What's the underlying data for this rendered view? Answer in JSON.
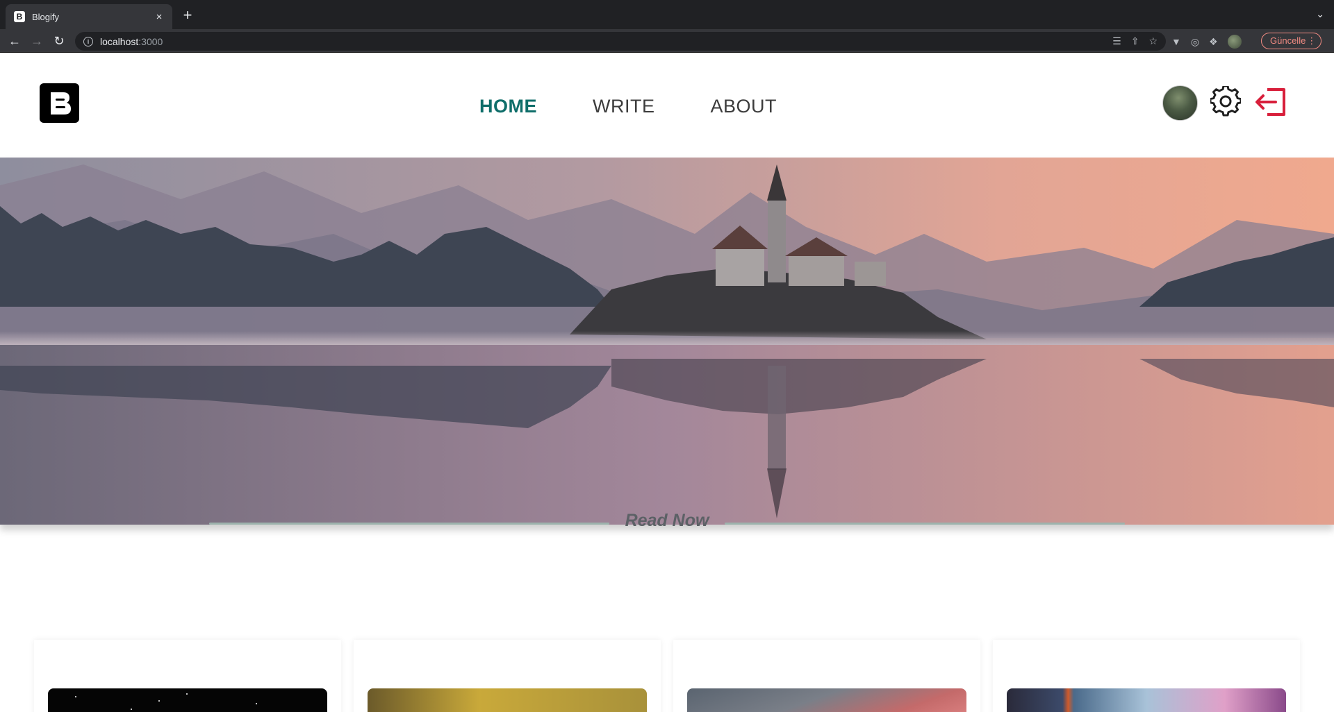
{
  "browser": {
    "tab_title": "Blogify",
    "tab_favicon_letter": "B",
    "tab_close": "×",
    "new_tab": "+",
    "url_host": "localhost",
    "url_port": ":3000",
    "update_label": "Güncelle"
  },
  "header": {
    "logo_letter": "B",
    "nav": [
      {
        "label": "HOME",
        "active": true
      },
      {
        "label": "WRITE",
        "active": false
      },
      {
        "label": "ABOUT",
        "active": false
      }
    ]
  },
  "section": {
    "title": "Read Now"
  },
  "colors": {
    "accent": "#0f6e6a",
    "logout": "#d81f3b",
    "divider": "#9db3ad"
  }
}
